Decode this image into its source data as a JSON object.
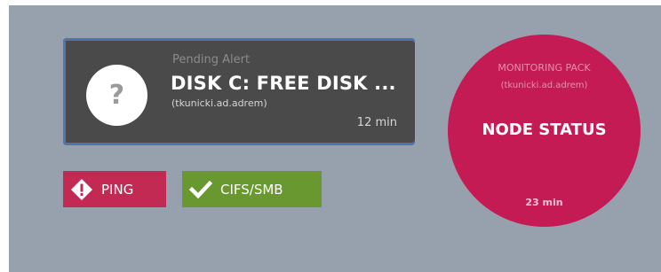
{
  "alert": {
    "label": "Pending Alert",
    "title": "DISK C: FREE DISK ...",
    "host": "(tkunicki.ad.adrem)",
    "time": "12 min",
    "icon": "question-icon",
    "icon_glyph": "?"
  },
  "badges": [
    {
      "label": "PING",
      "icon": "warning-diamond-icon",
      "color": "#c32a53"
    },
    {
      "label": "CIFS/SMB",
      "icon": "checkmark-icon",
      "color": "#68982f"
    }
  ],
  "status": {
    "pack_label": "MONITORING PACK",
    "host": "(tkunicki.ad.adrem)",
    "title": "NODE STATUS",
    "time": "23 min",
    "color": "#c41b55"
  },
  "colors": {
    "background": "#97a1ad",
    "card": "#4a4a4a",
    "card_border": "#4f74b1"
  }
}
